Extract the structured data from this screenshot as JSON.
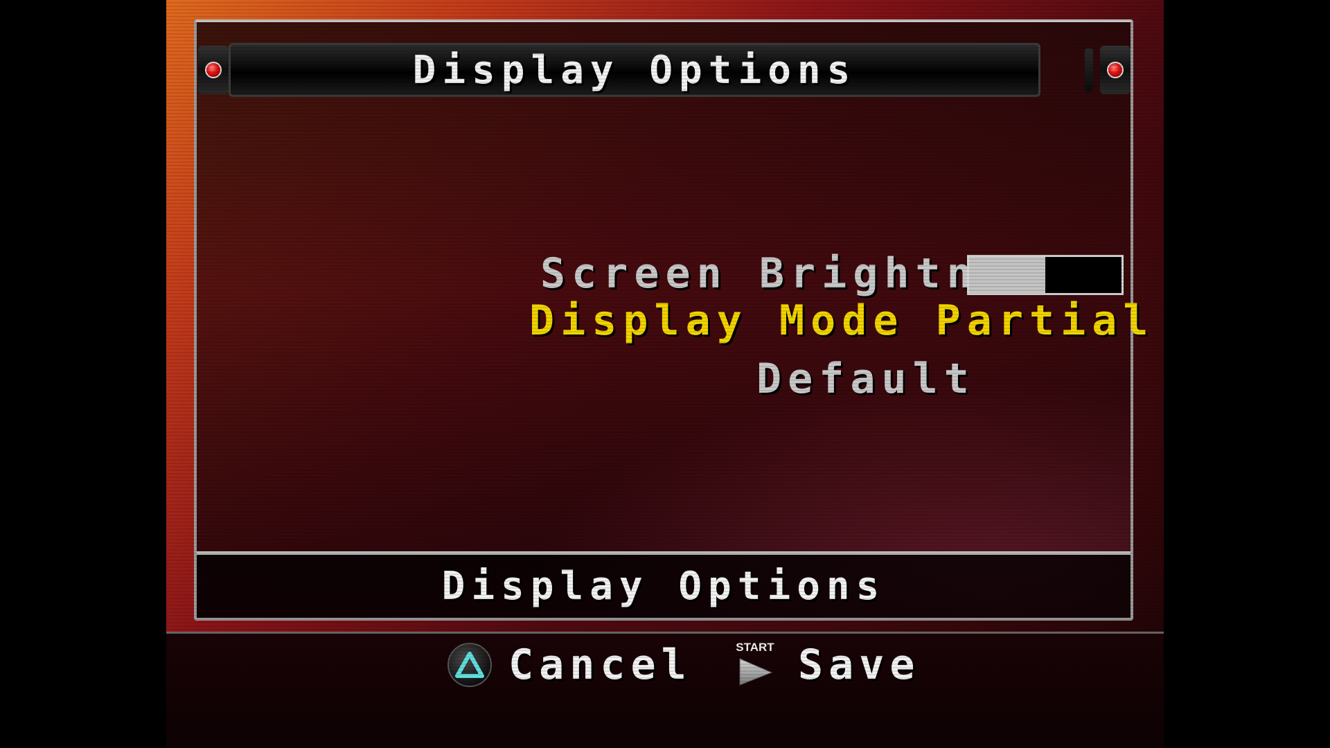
{
  "header": {
    "title": "Display Options"
  },
  "menu": {
    "brightness_label": "Screen Brightness",
    "brightness_level": 0.5,
    "display_mode_label": "Display Mode",
    "display_mode_value": "Partial Display",
    "default_label": "Default"
  },
  "info_bar": {
    "text": "Display Options"
  },
  "controls": {
    "cancel_label": "Cancel",
    "cancel_icon": "triangle-button-icon",
    "start_icon_label": "START",
    "save_label": "Save",
    "save_icon": "start-button-icon"
  },
  "colors": {
    "selected_text": "#f2d400",
    "normal_text": "#c8c8c8",
    "triangle_cyan": "#5ee0e0",
    "endcap_red": "#e01010"
  }
}
